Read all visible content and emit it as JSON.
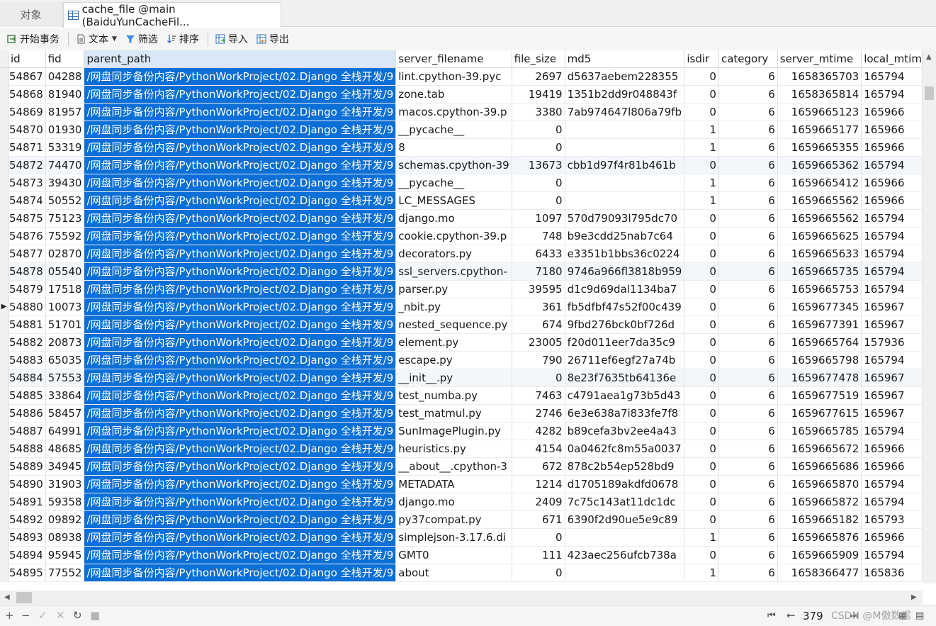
{
  "tabs": [
    {
      "label": "对象"
    },
    {
      "label": "cache_file @main (BaiduYunCacheFil..."
    }
  ],
  "toolbar": {
    "begin_transaction": "开始事务",
    "text": "文本",
    "filter": "筛选",
    "sort": "排序",
    "import": "导入",
    "export": "导出"
  },
  "columns": [
    "id",
    "fid",
    "parent_path",
    "server_filename",
    "file_size",
    "md5",
    "isdir",
    "category",
    "server_mtime",
    "local_mtim"
  ],
  "path_value": "/网盘同步备份内容/PythonWorkProject/02.Django 全栈开发/9",
  "rows": [
    {
      "id": "54867",
      "fid": "04288",
      "fn": "lint.cpython-39.pyc",
      "size": "2697",
      "md5": "d5637aebem228355",
      "isdir": "0",
      "cat": "6",
      "smt": "1658365703",
      "lmt": "165794"
    },
    {
      "id": "54868",
      "fid": "81940",
      "fn": "zone.tab",
      "size": "19419",
      "md5": "1351b2dd9r048843f",
      "isdir": "0",
      "cat": "6",
      "smt": "1658365814",
      "lmt": "165794"
    },
    {
      "id": "54869",
      "fid": "81957",
      "fn": "macos.cpython-39.p",
      "size": "3380",
      "md5": "7ab974647l806a79fb",
      "isdir": "0",
      "cat": "6",
      "smt": "1659665123",
      "lmt": "165966"
    },
    {
      "id": "54870",
      "fid": "01930",
      "fn": "__pycache__",
      "size": "0",
      "md5": "",
      "isdir": "1",
      "cat": "6",
      "smt": "1659665177",
      "lmt": "165966"
    },
    {
      "id": "54871",
      "fid": "53319",
      "fn": "8",
      "size": "0",
      "md5": "",
      "isdir": "1",
      "cat": "6",
      "smt": "1659665355",
      "lmt": "165966"
    },
    {
      "id": "54872",
      "fid": "74470",
      "fn": "schemas.cpython-39",
      "size": "13673",
      "md5": "cbb1d97f4r81b461b",
      "isdir": "0",
      "cat": "6",
      "smt": "1659665362",
      "lmt": "165794"
    },
    {
      "id": "54873",
      "fid": "39430",
      "fn": "__pycache__",
      "size": "0",
      "md5": "",
      "isdir": "1",
      "cat": "6",
      "smt": "1659665412",
      "lmt": "165966"
    },
    {
      "id": "54874",
      "fid": "50552",
      "fn": "LC_MESSAGES",
      "size": "0",
      "md5": "",
      "isdir": "1",
      "cat": "6",
      "smt": "1659665562",
      "lmt": "165966"
    },
    {
      "id": "54875",
      "fid": "75123",
      "fn": "django.mo",
      "size": "1097",
      "md5": "570d79093l795dc70",
      "isdir": "0",
      "cat": "6",
      "smt": "1659665562",
      "lmt": "165794"
    },
    {
      "id": "54876",
      "fid": "75592",
      "fn": "cookie.cpython-39.p",
      "size": "748",
      "md5": "b9e3cdd25nab7c64",
      "isdir": "0",
      "cat": "6",
      "smt": "1659665625",
      "lmt": "165794"
    },
    {
      "id": "54877",
      "fid": "02870",
      "fn": "decorators.py",
      "size": "6433",
      "md5": "e3351b1bbs36c0224",
      "isdir": "0",
      "cat": "6",
      "smt": "1659665633",
      "lmt": "165794"
    },
    {
      "id": "54878",
      "fid": "05540",
      "fn": "ssl_servers.cpython-",
      "size": "7180",
      "md5": "9746a966fl3818b959",
      "isdir": "0",
      "cat": "6",
      "smt": "1659665735",
      "lmt": "165794"
    },
    {
      "id": "54879",
      "fid": "17518",
      "fn": "parser.py",
      "size": "39595",
      "md5": "d1c9d69dal1134ba7",
      "isdir": "0",
      "cat": "6",
      "smt": "1659665753",
      "lmt": "165794"
    },
    {
      "id": "54880",
      "fid": "10073",
      "fn": "_nbit.py",
      "size": "361",
      "md5": "fb5dfbf47s52f00c439",
      "isdir": "0",
      "cat": "6",
      "smt": "1659677345",
      "lmt": "165967"
    },
    {
      "id": "54881",
      "fid": "51701",
      "fn": "nested_sequence.py",
      "size": "674",
      "md5": "9fbd276bck0bf726d",
      "isdir": "0",
      "cat": "6",
      "smt": "1659677391",
      "lmt": "165967"
    },
    {
      "id": "54882",
      "fid": "20873",
      "fn": "element.py",
      "size": "23005",
      "md5": "f20d011eer7da35c9",
      "isdir": "0",
      "cat": "6",
      "smt": "1659665764",
      "lmt": "157936"
    },
    {
      "id": "54883",
      "fid": "65035",
      "fn": "escape.py",
      "size": "790",
      "md5": "26711ef6egf27a74b",
      "isdir": "0",
      "cat": "6",
      "smt": "1659665798",
      "lmt": "165794"
    },
    {
      "id": "54884",
      "fid": "57553",
      "fn": "__init__.py",
      "size": "0",
      "md5": "8e23f7635tb64136e",
      "isdir": "0",
      "cat": "6",
      "smt": "1659677478",
      "lmt": "165967"
    },
    {
      "id": "54885",
      "fid": "33864",
      "fn": "test_numba.py",
      "size": "7463",
      "md5": "c4791aea1g73b5d43",
      "isdir": "0",
      "cat": "6",
      "smt": "1659677519",
      "lmt": "165967"
    },
    {
      "id": "54886",
      "fid": "58457",
      "fn": "test_matmul.py",
      "size": "2746",
      "md5": "6e3e638a7i833fe7f8",
      "isdir": "0",
      "cat": "6",
      "smt": "1659677615",
      "lmt": "165967"
    },
    {
      "id": "54887",
      "fid": "64991",
      "fn": "SunImagePlugin.py",
      "size": "4282",
      "md5": "b89cefa3bv2ee4a43",
      "isdir": "0",
      "cat": "6",
      "smt": "1659665785",
      "lmt": "165794"
    },
    {
      "id": "54888",
      "fid": "48685",
      "fn": "heuristics.py",
      "size": "4154",
      "md5": "0a0462fc8m55a0037",
      "isdir": "0",
      "cat": "6",
      "smt": "1659665672",
      "lmt": "165966"
    },
    {
      "id": "54889",
      "fid": "34945",
      "fn": "__about__.cpython-3",
      "size": "672",
      "md5": "878c2b54ep528bd9",
      "isdir": "0",
      "cat": "6",
      "smt": "1659665686",
      "lmt": "165966"
    },
    {
      "id": "54890",
      "fid": "31903",
      "fn": "METADATA",
      "size": "1214",
      "md5": "d1705189akdfd0678",
      "isdir": "0",
      "cat": "6",
      "smt": "1659665870",
      "lmt": "165794"
    },
    {
      "id": "54891",
      "fid": "59358",
      "fn": "django.mo",
      "size": "2409",
      "md5": "7c75c143at11dc1dc",
      "isdir": "0",
      "cat": "6",
      "smt": "1659665872",
      "lmt": "165794"
    },
    {
      "id": "54892",
      "fid": "09892",
      "fn": "py37compat.py",
      "size": "671",
      "md5": "6390f2d90ue5e9c89",
      "isdir": "0",
      "cat": "6",
      "smt": "1659665182",
      "lmt": "165793"
    },
    {
      "id": "54893",
      "fid": "08938",
      "fn": "simplejson-3.17.6.di",
      "size": "0",
      "md5": "",
      "isdir": "1",
      "cat": "6",
      "smt": "1659665876",
      "lmt": "165966"
    },
    {
      "id": "54894",
      "fid": "95945",
      "fn": "GMT0",
      "size": "111",
      "md5": "423aec256ufcb738a",
      "isdir": "0",
      "cat": "6",
      "smt": "1659665909",
      "lmt": "165794"
    },
    {
      "id": "54895",
      "fid": "77552",
      "fn": "about",
      "size": "0",
      "md5": "",
      "isdir": "1",
      "cat": "6",
      "smt": "1658366477",
      "lmt": "165836"
    }
  ],
  "status": {
    "page": "379",
    "watermark": "CSDN @M傲数据"
  },
  "icons": {
    "add": "plus-icon",
    "remove": "minus-icon",
    "apply": "check-icon",
    "cancel": "x-icon",
    "refresh": "refresh-icon",
    "stop": "stop-icon",
    "first": "first-page-icon",
    "prev": "prev-page-icon",
    "next": "next-page-icon",
    "last": "last-page-icon",
    "grid_view": "grid-view-icon",
    "form_view": "form-view-icon"
  },
  "colors": {
    "selection": "#0a6fd6",
    "selected_header": "#d9e7f7"
  }
}
